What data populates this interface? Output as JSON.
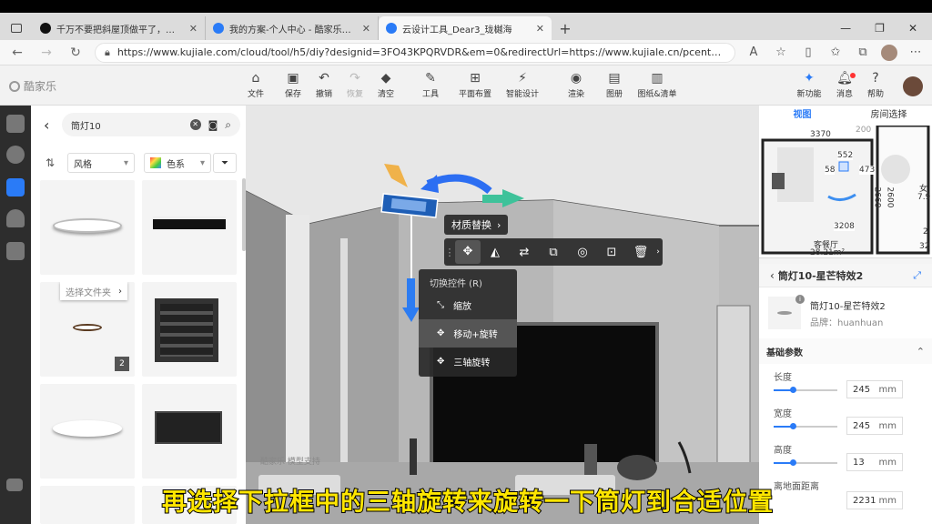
{
  "browser": {
    "tabs": [
      {
        "label": "千万不要把斜屋顶做平了，做人..."
      },
      {
        "label": "我的方案-个人中心 - 酷家乐云设..."
      },
      {
        "label": "云设计工具_Dear3_珑樾海"
      }
    ],
    "url": "https://www.kujiale.com/cloud/tool/h5/diy?designid=3FO43KPQRVDR&em=0&redirectUrl=https://www.kujiale.cn/pcenter/design/..."
  },
  "app": {
    "logo": "酷家乐",
    "tools": [
      {
        "label": "文件",
        "icon": "house-icon"
      },
      {
        "label": "保存",
        "icon": "save-icon"
      },
      {
        "label": "撤销",
        "icon": "undo-icon"
      },
      {
        "label": "恢复",
        "icon": "redo-icon"
      },
      {
        "label": "清空",
        "icon": "eraser-icon"
      },
      {
        "label": "工具",
        "icon": "wrench-icon"
      },
      {
        "label": "平面布置",
        "icon": "layout-icon"
      },
      {
        "label": "智能设计",
        "icon": "smart-icon"
      },
      {
        "label": "渲染",
        "icon": "camera-icon"
      },
      {
        "label": "图册",
        "icon": "album-icon"
      },
      {
        "label": "图纸&清单",
        "icon": "drawing-icon"
      }
    ],
    "right_tools": [
      {
        "label": "新功能"
      },
      {
        "label": "消息"
      },
      {
        "label": "帮助"
      }
    ]
  },
  "library": {
    "search_value": "筒灯10",
    "filter_style": "风格",
    "filter_color": "色系",
    "folder_tooltip": "选择文件夹",
    "badge": "2"
  },
  "scene": {
    "material_replace": "材质替换",
    "context_menu": {
      "title": "切换控件 (R)",
      "items": [
        "缩放",
        "移动+旋转",
        "三轴旋转"
      ]
    },
    "watermark": "酷家乐 模型支持"
  },
  "minimap": {
    "tabs": [
      "视图",
      "房间选择"
    ],
    "dims": [
      "3370",
      "552",
      "58",
      "473",
      "2660",
      "3208",
      "200",
      "2600"
    ],
    "room": "客餐厅",
    "area": "28.21m²",
    "partial_room": "女",
    "partial_area": "7.9",
    "edge_a": "2",
    "edge_b": "32"
  },
  "props": {
    "title": "筒灯10-星芒特效2",
    "name": "筒灯10-星芒特效2",
    "brand": "品牌：huanhuan",
    "section": "基础参数",
    "params": [
      {
        "label": "长度",
        "value": "245",
        "unit": "mm"
      },
      {
        "label": "宽度",
        "value": "245",
        "unit": "mm"
      },
      {
        "label": "高度",
        "value": "13",
        "unit": "mm"
      },
      {
        "label": "离地面距离",
        "value": "2231",
        "unit": "mm"
      }
    ]
  },
  "subtitle": "再选择下拉框中的三轴旋转来旋转一下筒灯到合适位置"
}
